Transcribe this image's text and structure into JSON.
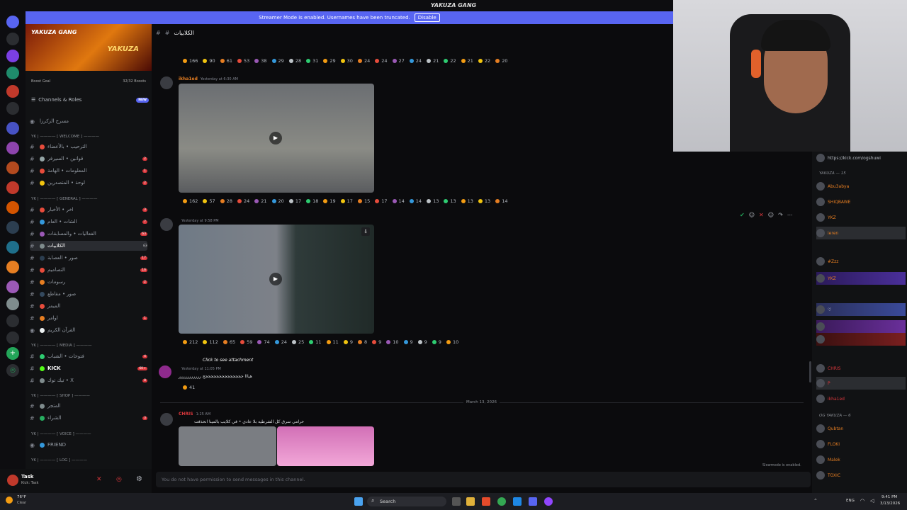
{
  "window": {
    "title": "YAKUZA GANG"
  },
  "streamer_banner": {
    "text": "Streamer Mode is enabled. Usernames have been truncated.",
    "button": "Disable"
  },
  "server": {
    "name": "YAKUZA GANG",
    "banner_logo": "YAKUZA",
    "boost_goal_label": "Boost Goal",
    "boost_count": "32/32 Boosts",
    "channels_roles": "Channels & Roles",
    "new_badge": "NEW",
    "voice_top": "مسرح الزكرزا",
    "categories": [
      {
        "label": "YK | ———— [ WELCOME ] ————"
      },
      {
        "label": "YK | ———— [ GENERAL ] ————"
      },
      {
        "label": "YK | ———— [ MEDIA ] ————"
      },
      {
        "label": "YK | ———— [ SHOP ] ————"
      },
      {
        "label": "YK | ———— [ VOICE ] ————"
      },
      {
        "label": "YK | ———— [ LOG ] ————"
      }
    ],
    "channels": [
      {
        "name": "الترحيب • بالأعضاء",
        "badge": ""
      },
      {
        "name": "قوانين • السيرفر",
        "badge": "2"
      },
      {
        "name": "المعلومات • الهامة",
        "badge": "1"
      },
      {
        "name": "لوحة • المتصدرين",
        "badge": "2"
      },
      {
        "name": "اخر • الأخبار",
        "badge": "3"
      },
      {
        "name": "الشات • العام",
        "badge": "7"
      },
      {
        "name": "الفعاليات • والمسابقات",
        "badge": "63"
      },
      {
        "name": "الكلابيات",
        "badge": ""
      },
      {
        "name": "صور • العصابة",
        "badge": "17"
      },
      {
        "name": "التصاميم",
        "badge": "16"
      },
      {
        "name": "رسومات",
        "badge": "2"
      },
      {
        "name": "صور • مقاطع",
        "badge": ""
      },
      {
        "name": "الميمز",
        "badge": ""
      },
      {
        "name": "اوامر",
        "badge": "1"
      },
      {
        "name": "القرآن الكريم",
        "badge": ""
      },
      {
        "name": "فتوحات • الشباب",
        "badge": "4"
      },
      {
        "name": "KICK",
        "badge": "6K+"
      },
      {
        "name": "تيك توك • X",
        "badge": "8"
      },
      {
        "name": "المتجر",
        "badge": ""
      },
      {
        "name": "الشراء",
        "badge": "3"
      },
      {
        "name": "FRIEND",
        "badge": ""
      }
    ]
  },
  "user": {
    "name": "Task",
    "status": "Kick: Task"
  },
  "chat": {
    "channel_title": "الكلابيات",
    "messages": [
      {
        "author": "ikha1ed",
        "time": "Yesterday at 6:30 AM"
      },
      {
        "author": "",
        "time": "Yesterday at 9:58 PM"
      },
      {
        "author": "",
        "time": "Yesterday at 11:05 PM",
        "attachment": "Click to see attachment",
        "text": "هيااا ججججججججججججججج ررررررررررر"
      },
      {
        "author": "CHRIS",
        "time": "1:25 AM",
        "text": "حرامي سرق كل الشرطيه بلا عادي • في كلايب بالمينا انحذفت"
      }
    ],
    "reactions_row1": [
      "166",
      "90",
      "61",
      "53",
      "38",
      "29",
      "28",
      "31",
      "29",
      "30",
      "24",
      "24",
      "27",
      "24",
      "21",
      "22",
      "21",
      "22",
      "20"
    ],
    "reactions_row2": [
      "162",
      "57",
      "28",
      "24",
      "21",
      "20",
      "17",
      "18",
      "19",
      "17",
      "15",
      "17",
      "14",
      "14",
      "13",
      "13",
      "13",
      "13",
      "14"
    ],
    "reactions_row3": [
      "212",
      "112",
      "65",
      "59",
      "74",
      "24",
      "25",
      "11",
      "11",
      "9",
      "8",
      "9",
      "10",
      "9",
      "9",
      "9",
      "10"
    ],
    "reactions_row4": [
      "41"
    ],
    "date_divider": "March 13, 2026",
    "composer_placeholder": "You do not have permission to send messages in this channel.",
    "slowmode": "Slowmode is enabled."
  },
  "members": {
    "groups": [
      {
        "label": "YAKUZA — 15"
      },
      {
        "label": "OG YAKUZA — 6"
      }
    ],
    "items": [
      {
        "name": "https://kick.com/ogshuwi",
        "color": "#b5bac1"
      },
      {
        "name": "Abu3abya",
        "color": "#e67e22"
      },
      {
        "name": "SHIQBAWE",
        "color": "#e67e22"
      },
      {
        "name": "YKZ",
        "color": "#e67e22"
      },
      {
        "name": "ieren",
        "color": "#e67e22"
      },
      {
        "name": "#Zzz",
        "color": "#e67e22"
      },
      {
        "name": "YKZ",
        "color": "#e67e22"
      },
      {
        "name": "CHRIS",
        "color": "#e67e22"
      },
      {
        "name": "P",
        "color": "#e67e22"
      },
      {
        "name": "ikha1ed",
        "color": "#e67e22"
      },
      {
        "name": "Qubtan",
        "color": "#e67e22"
      },
      {
        "name": "FLOKI",
        "color": "#e67e22"
      },
      {
        "name": "Malek",
        "color": "#e67e22"
      },
      {
        "name": "TOXIC",
        "color": "#e67e22"
      }
    ]
  },
  "taskbar": {
    "weather_temp": "76°F",
    "weather_desc": "Clear",
    "search": "Search",
    "lang": "ENG",
    "time": "9:41 PM",
    "date": "3/13/2026"
  }
}
